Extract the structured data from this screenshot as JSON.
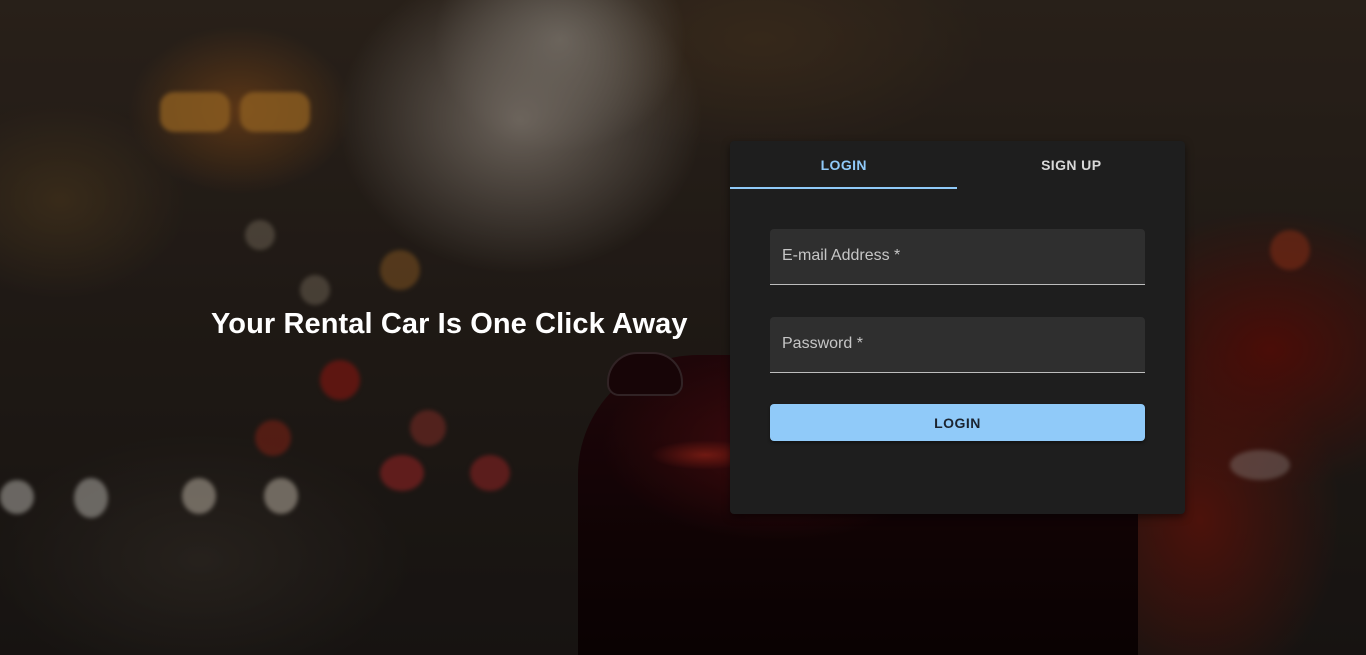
{
  "hero": {
    "headline": "Your Rental Car Is One Click Away"
  },
  "auth": {
    "tabs": [
      {
        "label": "LOGIN",
        "active": true
      },
      {
        "label": "SIGN UP",
        "active": false
      }
    ],
    "email": {
      "label": "E-mail Address *",
      "value": ""
    },
    "password": {
      "label": "Password *",
      "value": ""
    },
    "submit_label": "LOGIN"
  },
  "colors": {
    "accent": "#90caf9",
    "panel": "#1e1e1e",
    "field": "#2f2f2f"
  }
}
